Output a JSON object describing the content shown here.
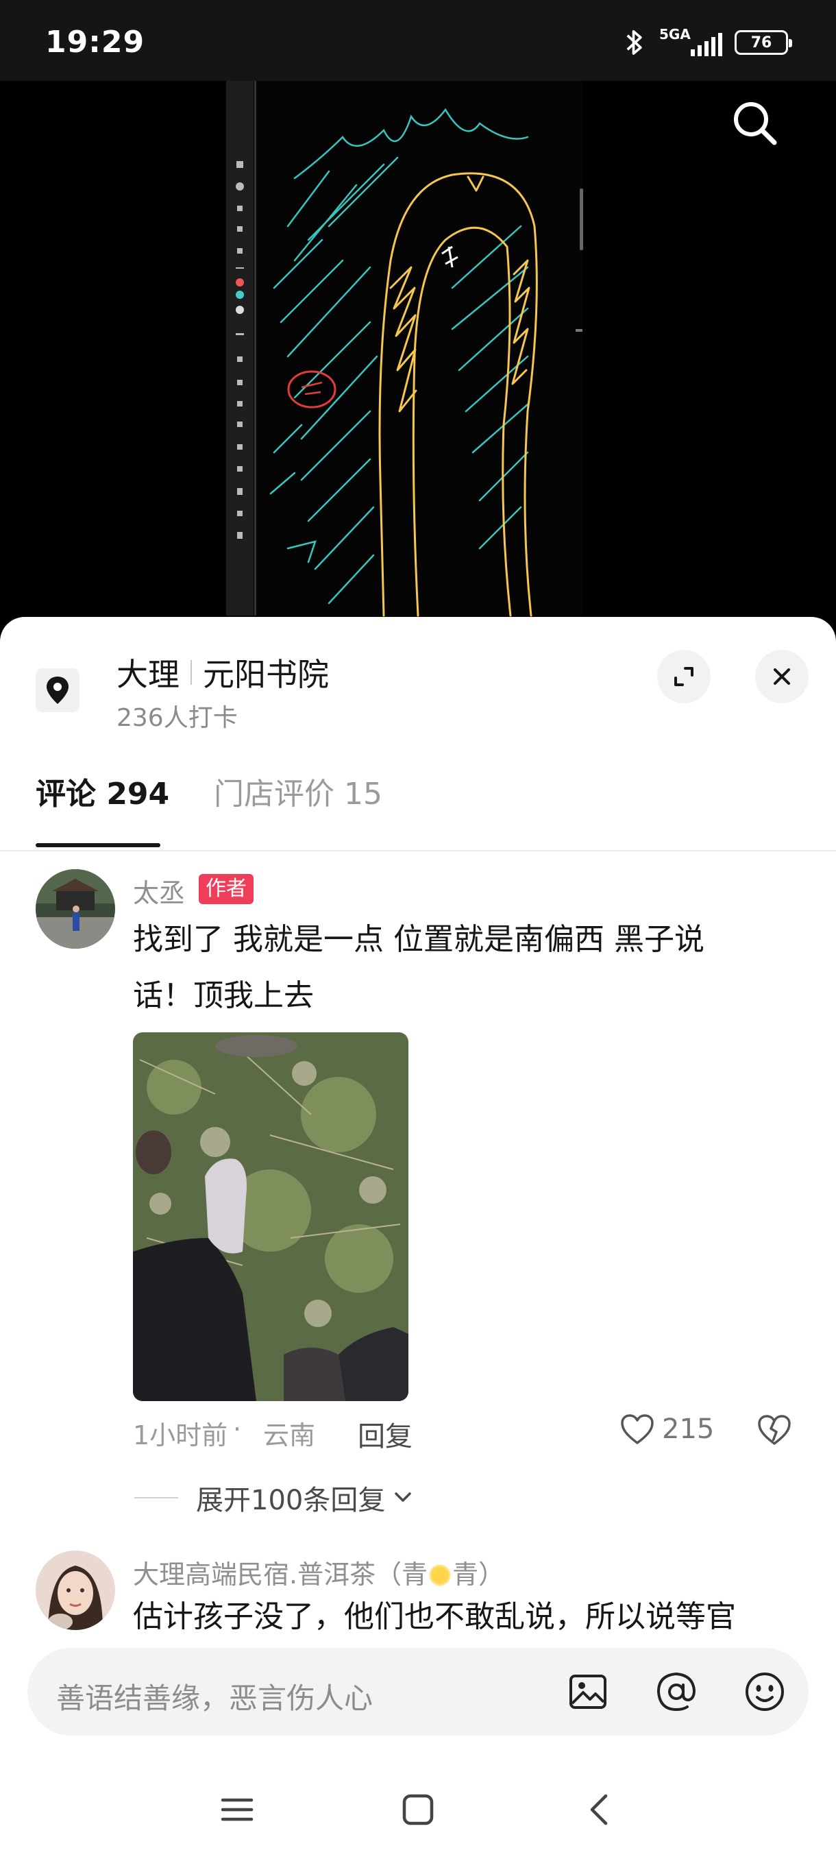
{
  "status_bar": {
    "time": "19:29",
    "network": "5GA",
    "battery": "76"
  },
  "location": {
    "city": "大理",
    "place": "元阳书院",
    "checkins": "236人打卡"
  },
  "tabs": [
    {
      "label": "评论 294",
      "active": true
    },
    {
      "label": "门店评价 15",
      "active": false
    }
  ],
  "comments": [
    {
      "author": "太丞",
      "badge": "作者",
      "text_line1": "找到了 我就是一点 位置就是南偏西 黑子说",
      "text_line2": "话！顶我上去",
      "time": "1小时前",
      "region": "云南",
      "reply_label": "回复",
      "likes": "215",
      "expand_label": "展开100条回复"
    },
    {
      "author_prefix": "大理高端民宿.普洱茶（青",
      "author_suffix": "青）",
      "text_line1": "估计孩子没了，他们也不敢乱说，所以说等官"
    }
  ],
  "input": {
    "placeholder": "善语结善缘，恶言伤人心"
  },
  "colors": {
    "accent_badge": "#ee3e5a",
    "sheet_bg": "#ffffff",
    "video_bg": "#000000"
  },
  "icons": [
    "search-icon",
    "location-pin-icon",
    "expand-icon",
    "close-icon",
    "heart-icon",
    "broken-heart-icon",
    "chevron-down-icon",
    "image-icon",
    "at-icon",
    "emoji-icon",
    "menu-icon",
    "home-icon",
    "back-icon"
  ]
}
